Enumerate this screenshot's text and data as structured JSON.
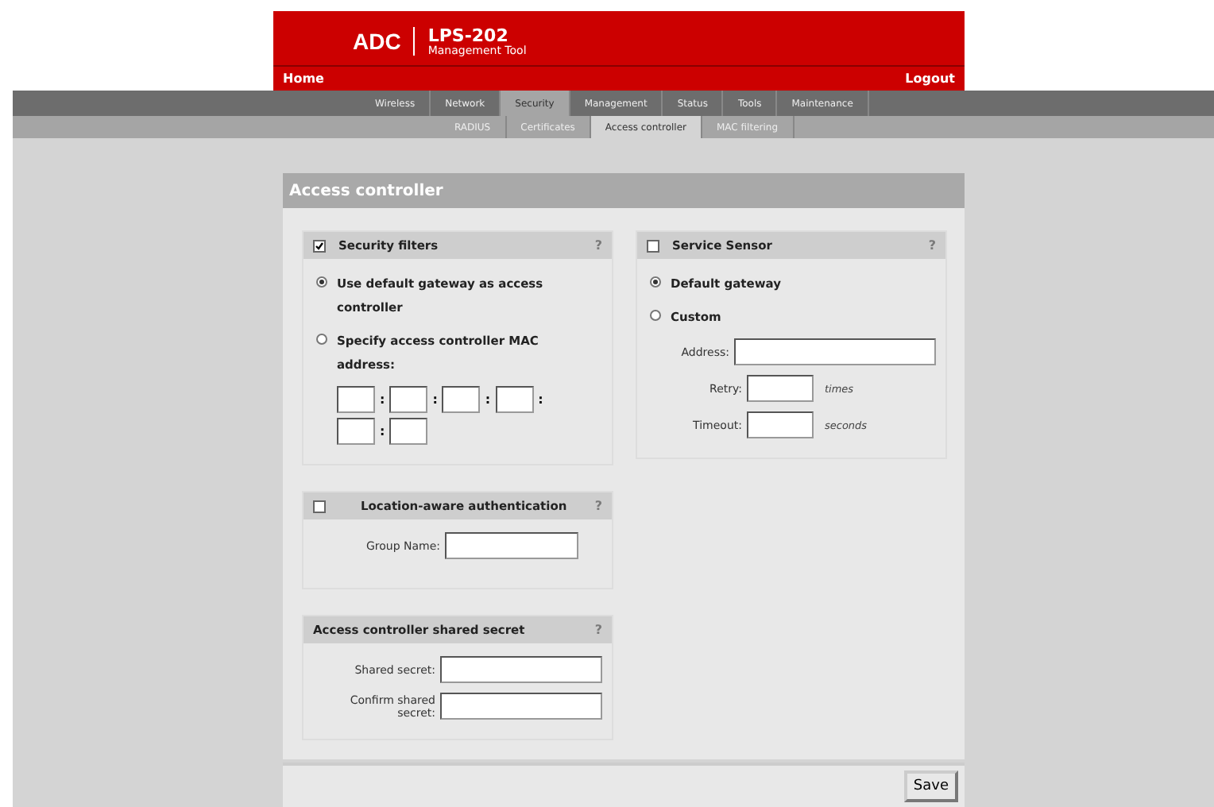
{
  "header": {
    "logo": "ADC",
    "product": "LPS-202",
    "subtitle": "Management Tool",
    "home": "Home",
    "logout": "Logout"
  },
  "tabs": [
    {
      "label": "Wireless",
      "selected": false
    },
    {
      "label": "Network",
      "selected": false
    },
    {
      "label": "Security",
      "selected": true
    },
    {
      "label": "Management",
      "selected": false
    },
    {
      "label": "Status",
      "selected": false
    },
    {
      "label": "Tools",
      "selected": false
    },
    {
      "label": "Maintenance",
      "selected": false
    }
  ],
  "subtabs": [
    {
      "label": "RADIUS",
      "selected": false
    },
    {
      "label": "Certificates",
      "selected": false
    },
    {
      "label": "Access controller",
      "selected": true
    },
    {
      "label": "MAC filtering",
      "selected": false
    }
  ],
  "panel_title": "Access controller",
  "security_filters": {
    "title": "Security filters",
    "checked": true,
    "help": "?",
    "options": [
      {
        "label": "Use default gateway as access controller",
        "selected": true
      },
      {
        "label": "Specify access controller MAC address:",
        "selected": false
      }
    ],
    "mac_fields": [
      {
        "kind": "octet",
        "separator": ":"
      },
      {
        "kind": "octet",
        "separator": ":"
      },
      {
        "kind": "octet",
        "separator": ":"
      },
      {
        "kind": "octet",
        "separator": ":"
      },
      {
        "kind": "octet",
        "separator": ":"
      },
      {
        "kind": "octet"
      }
    ]
  },
  "service_sensor": {
    "title": "Service Sensor",
    "checked": false,
    "help": "?",
    "options": [
      {
        "label": "Default gateway",
        "selected": true
      },
      {
        "label": "Custom",
        "selected": false
      }
    ],
    "fields": [
      {
        "label": "Address:",
        "kind": "wide"
      },
      {
        "label": "Retry:",
        "kind": "short",
        "unit": "times"
      },
      {
        "label": "Timeout:",
        "kind": "short",
        "unit": "seconds"
      }
    ]
  },
  "location_auth": {
    "title": "Location-aware authentication",
    "checked": false,
    "help": "?",
    "fields": [
      {
        "label": "Group Name:"
      }
    ]
  },
  "shared_secret": {
    "title": "Access controller shared secret",
    "help": "?",
    "fields": [
      {
        "label": "Shared secret:"
      },
      {
        "label": "Confirm shared secret:"
      }
    ]
  },
  "save_button": "Save"
}
